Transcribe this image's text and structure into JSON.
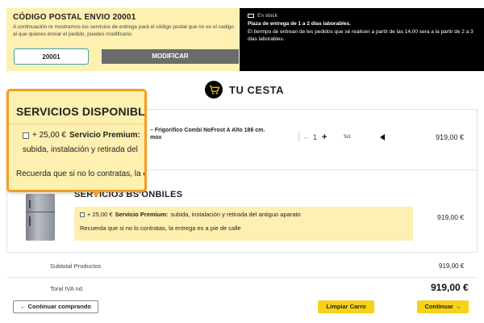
{
  "postal": {
    "title": "CÓDIGO POSTAL ENVIO 20001",
    "description": "A continuación re mostramos los servicios de entrega pará el código postal que no es el cadigo al que quieres énviar el pedido, puedes modificario.",
    "input_value": "20001",
    "button_label": "MODIFICAR"
  },
  "stock": {
    "status": "En stock",
    "headline": "Plaza de entrega de 1 a 2 dias laborables.",
    "text": "El tiermpo de entrean de les pedidos que sé realicen a partir de las 14,00 sera a la partir de 2 a 3 dias laborables."
  },
  "cart": {
    "title": "TU CESTA"
  },
  "product": {
    "name_line1": "– Frigorifico Combi NoFrost A Alto 186 cm.",
    "name_line2": "mox",
    "quantity": "1",
    "minus": "–",
    "plus": "+",
    "scl_label": "Scl",
    "price": "919,00 €"
  },
  "services": {
    "heading": "SERVICIO3 BS'ONBILES",
    "premium_price": "+ 25,00 €",
    "premium_label": "Servicio Premium:",
    "premium_desc": "subida, instalación y retirada del antiguo aparato",
    "note": "Recuerda que si no lo contratas, la entrega es a pie de calle",
    "price": "919,00 €"
  },
  "callout": {
    "title": "SERVICIOS DISPONIBLES",
    "line1_price": "+ 25,00 €",
    "line1_label": "Servicio Premium:",
    "line2": "subida, instalación y retirada del",
    "line3": "Recuerda que si no lo contratas, la e"
  },
  "totals": {
    "subtotal_label": "Subtotal Productos",
    "subtotal_value": "919,00 €",
    "total_label": "Toral IVA nd.",
    "total_value": "919,00 €"
  },
  "actions": {
    "back_label": "← Continuar comprando",
    "clear_label": "Limpiar Carro",
    "continue_label": "Continuar →"
  }
}
